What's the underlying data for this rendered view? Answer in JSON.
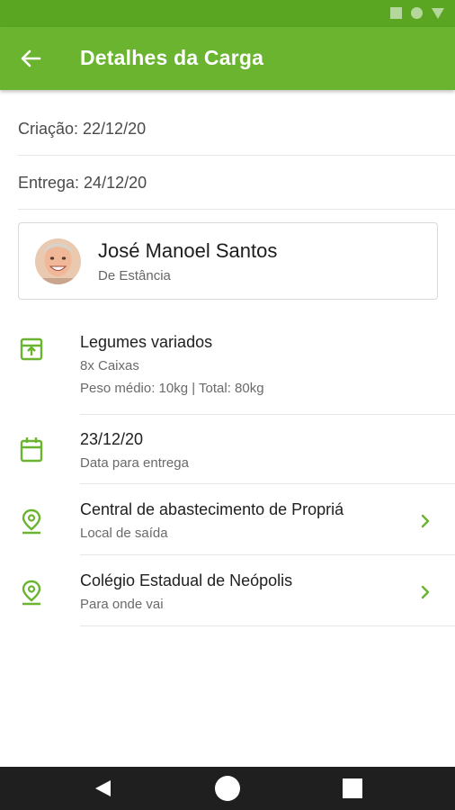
{
  "header": {
    "title": "Detalhes da Carga",
    "accent_color": "#6ab42f",
    "status_bar_color": "#5aa623"
  },
  "dates": {
    "creation": "Criação: 22/12/20",
    "delivery": "Entrega: 24/12/20"
  },
  "person": {
    "name": "José Manoel Santos",
    "subtitle": "De Estância"
  },
  "details": [
    {
      "icon": "package-icon",
      "title": "Legumes variados",
      "lines": [
        "8x Caixas",
        "Peso médio: 10kg | Total: 80kg"
      ]
    },
    {
      "icon": "calendar-icon",
      "title": "23/12/20",
      "lines": [
        "Data para entrega"
      ]
    },
    {
      "icon": "location-pin-icon",
      "title": "Central de abastecimento de Propriá",
      "lines": [
        "Local de saída"
      ]
    },
    {
      "icon": "location-pin-icon",
      "title": "Colégio Estadual de Neópolis",
      "lines": [
        "Para onde vai"
      ]
    }
  ],
  "icons": {
    "back": "arrow-left-icon",
    "chevron": "chevron-right-icon",
    "nav": [
      "triangle-back-icon",
      "circle-home-icon",
      "square-recents-icon"
    ]
  }
}
